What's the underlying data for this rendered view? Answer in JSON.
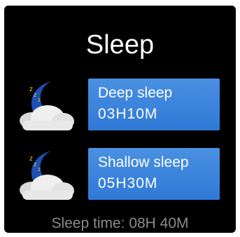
{
  "title": "Sleep",
  "deep": {
    "icon": "sleep-moon-cloud-icon",
    "label": "Deep sleep",
    "value": "03H10M"
  },
  "shallow": {
    "icon": "sleep-moon-cloud-icon",
    "label": "Shallow sleep",
    "value": "05H30M"
  },
  "footer": {
    "text": "Sleep time: 08H 40M"
  },
  "colors": {
    "background": "#000000",
    "card": "#3a86de",
    "moon": "#1e4fb2",
    "cloud": "#f2f2f2",
    "footer_text": "#8a8a8a"
  }
}
